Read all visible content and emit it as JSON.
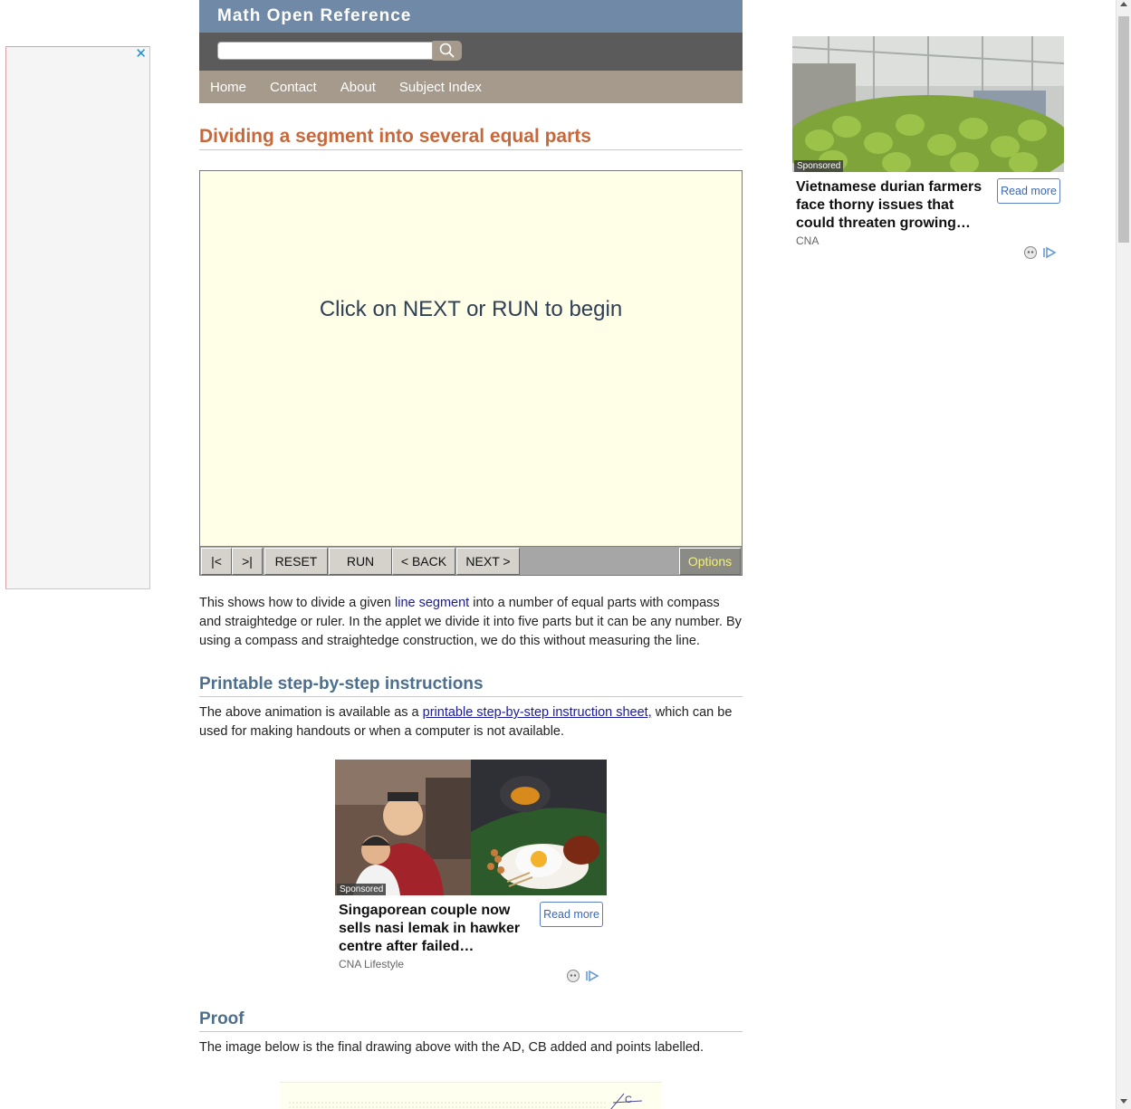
{
  "site": {
    "title": "Math Open Reference",
    "search_placeholder": "",
    "nav": [
      "Home",
      "Contact",
      "About",
      "Subject Index"
    ]
  },
  "page": {
    "title": "Dividing a segment into several equal parts"
  },
  "applet": {
    "message": "Click on NEXT or RUN to begin",
    "buttons": {
      "first": "|<",
      "last": ">|",
      "reset": "RESET",
      "run": "RUN",
      "back": "< BACK",
      "next": "NEXT >",
      "options": "Options"
    }
  },
  "intro": {
    "text_before": "This shows how to divide a given ",
    "link": "line segment",
    "text_after": " into a number of equal parts with compass and straightedge or ruler. In the applet we divide it into five parts but it can be any number. By using a compass and straightedge construction, we do this without measuring the line."
  },
  "printable": {
    "heading": "Printable step-by-step instructions",
    "text_before": "The above animation is available as a ",
    "link": "printable step-by-step instruction sheet,",
    "text_after": " which can be used for making handouts or when a computer is not available."
  },
  "proof": {
    "heading": "Proof",
    "text": "The image below is the final drawing above with the AD, CB added and points labelled.",
    "figure_label": "C"
  },
  "ads": {
    "left_close": "✕",
    "right": {
      "sponsored": "Sponsored",
      "headline": "Vietnamese durian farmers face thorny issues that could threaten growing…",
      "source": "CNA",
      "read_more": "Read more"
    },
    "middle": {
      "sponsored": "Sponsored",
      "headline": "Singaporean couple now sells nasi lemak in hawker centre after failed…",
      "source": "CNA Lifestyle",
      "read_more": "Read more"
    }
  },
  "colors": {
    "header_blue": "#7089a6",
    "search_gray": "#5b5b5b",
    "nav_tan": "#a59a8c",
    "title_orange": "#c8683a",
    "section_blue": "#4d6f8e",
    "applet_bg": "#ffffe8",
    "link_blue": "#1a1a9c"
  }
}
